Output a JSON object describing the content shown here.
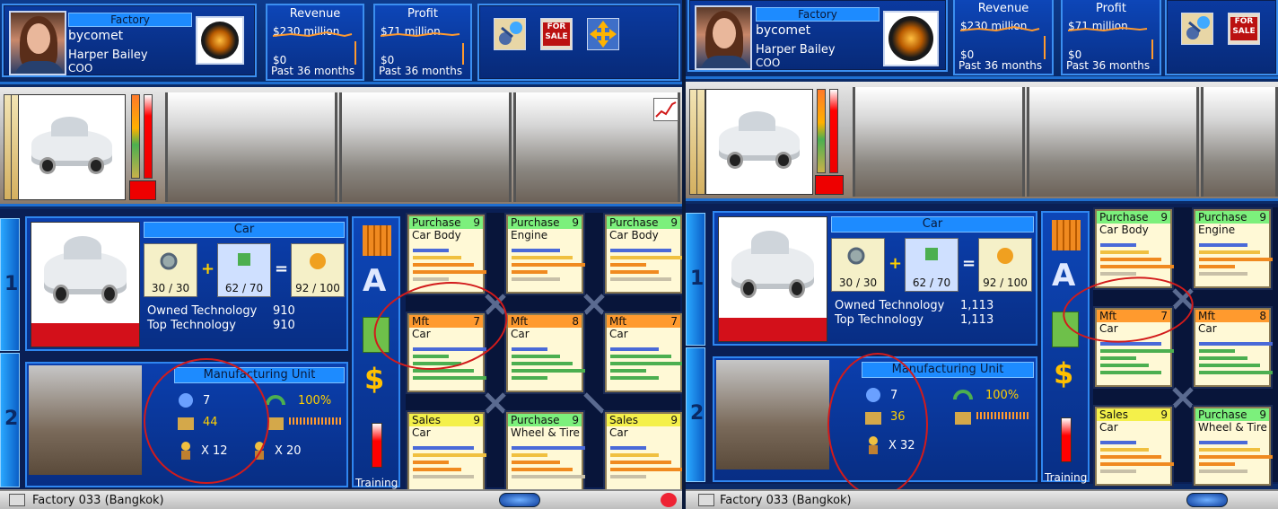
{
  "panels": [
    {
      "header": {
        "category": "Factory",
        "company": "bycomet",
        "person": "Harper Bailey",
        "role": "COO"
      },
      "revenue": {
        "title": "Revenue",
        "top": "$230 million",
        "bottom": "$0",
        "footer": "Past 36 months"
      },
      "profit": {
        "title": "Profit",
        "top": "$71 million",
        "bottom": "$0",
        "footer": "Past 36 months"
      },
      "product": {
        "name": "Car",
        "tech_a": "30 / 30",
        "tech_b": "62 / 70",
        "tech_c": "92 / 100",
        "owned_label": "Owned Technology",
        "owned_value": "910",
        "top_label": "Top Technology",
        "top_value": "910"
      },
      "unit": {
        "title": "Manufacturing Unit",
        "level": "7",
        "stock": "44",
        "efficiency": "100%",
        "workers_a": "X 12",
        "workers_b": "X 20"
      },
      "training": "Training",
      "cards": [
        {
          "head": "Purchase",
          "n": "9",
          "sub": "Car Body",
          "color": "#7cf07c"
        },
        {
          "head": "Purchase",
          "n": "9",
          "sub": "Engine",
          "color": "#7cf07c"
        },
        {
          "head": "Purchase",
          "n": "9",
          "sub": "Car Body",
          "color": "#7cf07c"
        },
        {
          "head": "Mft",
          "n": "7",
          "sub": "Car",
          "color": "#ff9a2e"
        },
        {
          "head": "Mft",
          "n": "8",
          "sub": "Car",
          "color": "#ff9a2e"
        },
        {
          "head": "Mft",
          "n": "7",
          "sub": "Car",
          "color": "#ff9a2e"
        },
        {
          "head": "Sales",
          "n": "9",
          "sub": "Car",
          "color": "#f4f04a"
        },
        {
          "head": "Purchase",
          "n": "9",
          "sub": "Wheel & Tire",
          "color": "#7cf07c"
        },
        {
          "head": "Sales",
          "n": "9",
          "sub": "Car",
          "color": "#f4f04a"
        }
      ],
      "status": "Factory 033 (Bangkok)"
    },
    {
      "header": {
        "category": "Factory",
        "company": "bycomet",
        "person": "Harper Bailey",
        "role": "COO"
      },
      "revenue": {
        "title": "Revenue",
        "top": "$230 million",
        "bottom": "$0",
        "footer": "Past 36 months"
      },
      "profit": {
        "title": "Profit",
        "top": "$71 million",
        "bottom": "$0",
        "footer": "Past 36 months"
      },
      "product": {
        "name": "Car",
        "tech_a": "30 / 30",
        "tech_b": "62 / 70",
        "tech_c": "92 / 100",
        "owned_label": "Owned Technology",
        "owned_value": "1,113",
        "top_label": "Top Technology",
        "top_value": "1,113"
      },
      "unit": {
        "title": "Manufacturing Unit",
        "level": "7",
        "stock": "36",
        "efficiency": "100%",
        "workers_a": "X 32"
      },
      "training": "Training",
      "cards": [
        {
          "head": "Purchase",
          "n": "9",
          "sub": "Car Body",
          "color": "#7cf07c"
        },
        {
          "head": "Purchase",
          "n": "9",
          "sub": "Engine",
          "color": "#7cf07c"
        },
        {
          "head": "Mft",
          "n": "7",
          "sub": "Car",
          "color": "#ff9a2e"
        },
        {
          "head": "Mft",
          "n": "8",
          "sub": "Car",
          "color": "#ff9a2e"
        },
        {
          "head": "Sales",
          "n": "9",
          "sub": "Car",
          "color": "#f4f04a"
        },
        {
          "head": "Purchase",
          "n": "9",
          "sub": "Wheel & Tire",
          "color": "#7cf07c"
        }
      ],
      "status": "Factory 033 (Bangkok)"
    }
  ],
  "sidetabs": [
    "1",
    "2"
  ],
  "icons": {
    "for_sale": "FOR SALE",
    "move": "move-arrows-icon",
    "assign": "assign-person-icon"
  }
}
